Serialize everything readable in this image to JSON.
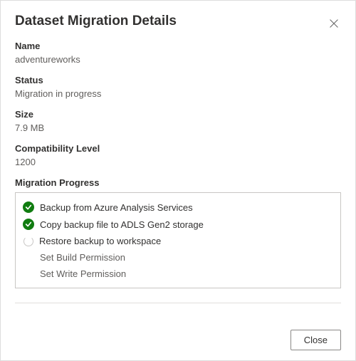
{
  "dialog": {
    "title": "Dataset Migration Details",
    "close_button_label": "Close"
  },
  "fields": {
    "name_label": "Name",
    "name_value": "adventureworks",
    "status_label": "Status",
    "status_value": "Migration in progress",
    "size_label": "Size",
    "size_value": "7.9 MB",
    "compat_label": "Compatibility Level",
    "compat_value": "1200"
  },
  "progress": {
    "heading": "Migration Progress",
    "steps": [
      {
        "label": "Backup from Azure Analysis Services",
        "state": "done"
      },
      {
        "label": "Copy backup file to ADLS Gen2 storage",
        "state": "done"
      },
      {
        "label": "Restore backup to workspace",
        "state": "running"
      },
      {
        "label": "Set Build Permission",
        "state": "pending"
      },
      {
        "label": "Set Write Permission",
        "state": "pending"
      }
    ]
  },
  "colors": {
    "success": "#107c10",
    "border": "#c8c6c4"
  }
}
